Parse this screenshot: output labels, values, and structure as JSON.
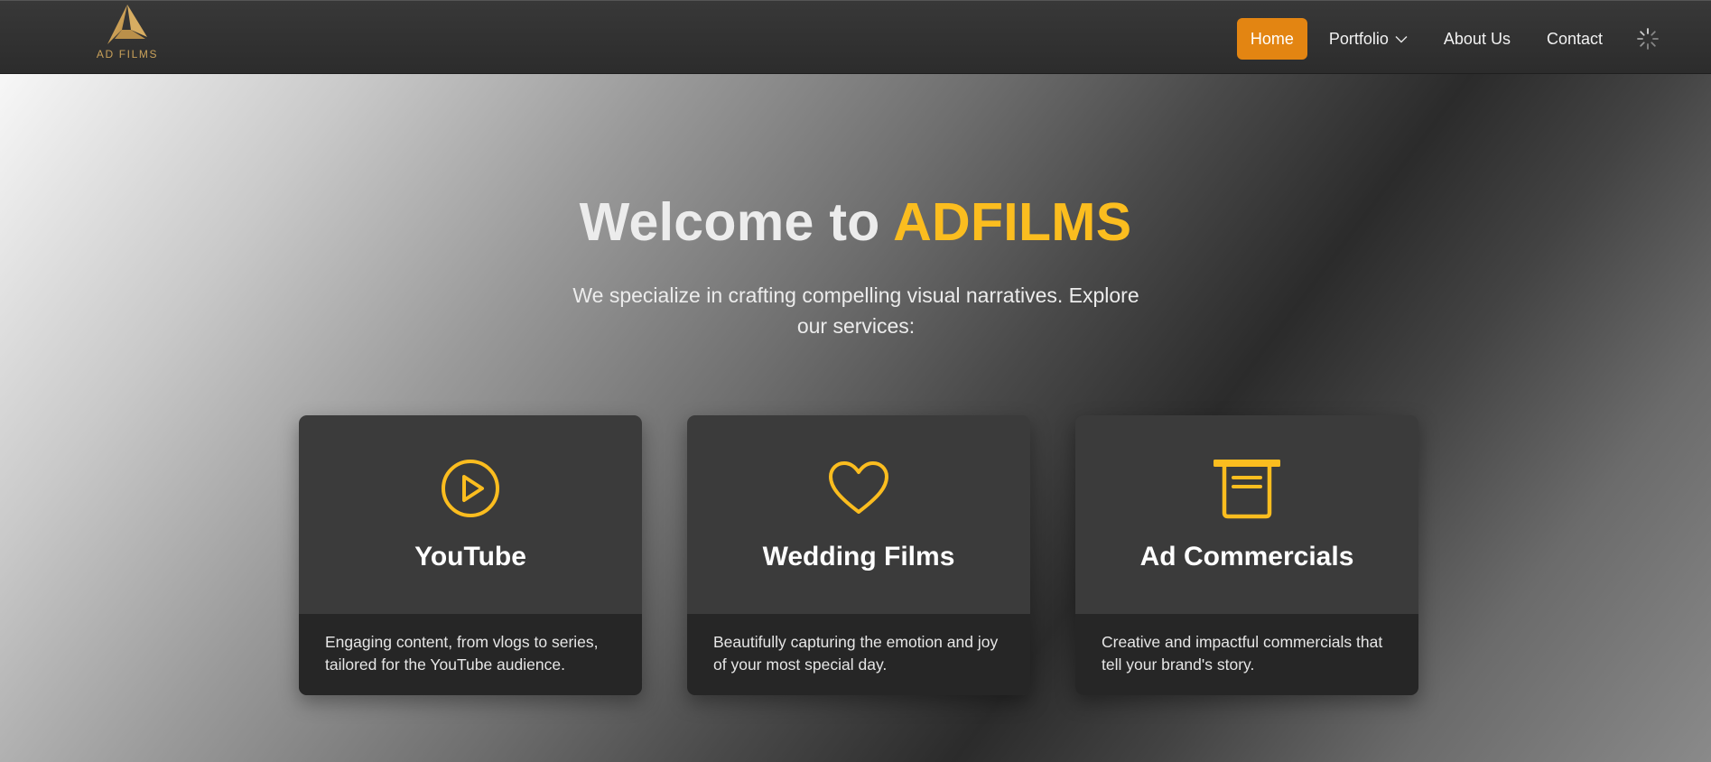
{
  "brand": {
    "logo_text": "AD FILMS",
    "accent_color": "#fbbd1f",
    "nav_active_color": "#e38512"
  },
  "nav": {
    "items": [
      {
        "label": "Home",
        "active": true
      },
      {
        "label": "Portfolio",
        "dropdown": true
      },
      {
        "label": "About Us"
      },
      {
        "label": "Contact"
      }
    ],
    "loading_icon": "spinner-icon"
  },
  "hero": {
    "title_prefix": "Welcome to ",
    "title_brand": "ADFILMS",
    "subtitle": "We specialize in crafting compelling visual narratives. Explore our services:"
  },
  "services": [
    {
      "icon": "play-circle-icon",
      "title": "YouTube",
      "description": "Engaging content, from vlogs to series, tailored for the YouTube audience."
    },
    {
      "icon": "heart-icon",
      "title": "Wedding Films",
      "description": "Beautifully capturing the emotion and joy of your most special day."
    },
    {
      "icon": "archive-box-icon",
      "title": "Ad Commercials",
      "description": "Creative and impactful commercials that tell your brand's story."
    }
  ]
}
